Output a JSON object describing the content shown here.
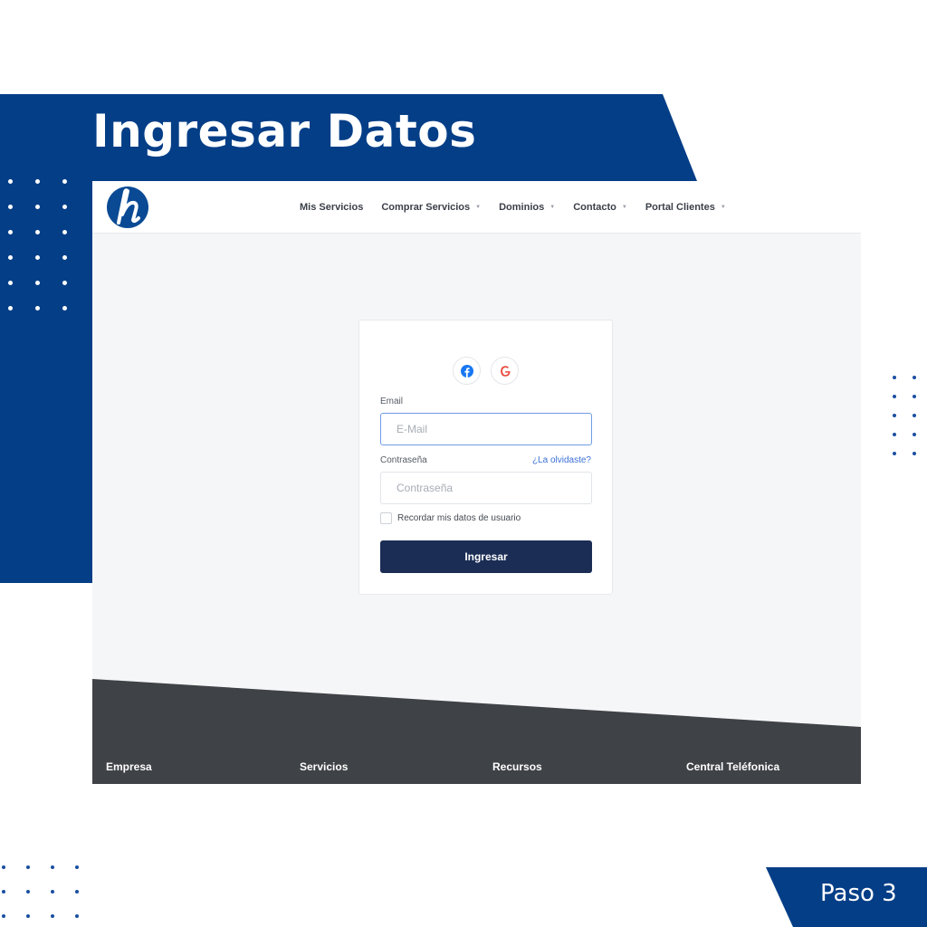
{
  "banner": {
    "title": "Ingresar Datos"
  },
  "step": {
    "label": "Paso 3"
  },
  "navbar": {
    "logo": "h-logo",
    "items": [
      {
        "label": "Mis Servicios",
        "dropdown": false
      },
      {
        "label": "Comprar Servicios",
        "dropdown": true
      },
      {
        "label": "Dominios",
        "dropdown": true
      },
      {
        "label": "Contacto",
        "dropdown": true
      },
      {
        "label": "Portal Clientes",
        "dropdown": true
      }
    ]
  },
  "login": {
    "social": [
      "facebook-icon",
      "google-icon"
    ],
    "email_label": "Email",
    "email_placeholder": "E-Mail",
    "password_label": "Contraseña",
    "forgot_link": "¿La olvidaste?",
    "password_placeholder": "Contraseña",
    "remember_label": "Recordar mis datos de usuario",
    "submit_label": "Ingresar"
  },
  "footer": {
    "columns": [
      "Empresa",
      "Servicios",
      "Recursos",
      "Central Teléfonica"
    ]
  },
  "colors": {
    "brand_blue": "#043e87",
    "button_navy": "#1b2d55",
    "footer_gray": "#3f4246",
    "link_blue": "#3b6fd6"
  }
}
